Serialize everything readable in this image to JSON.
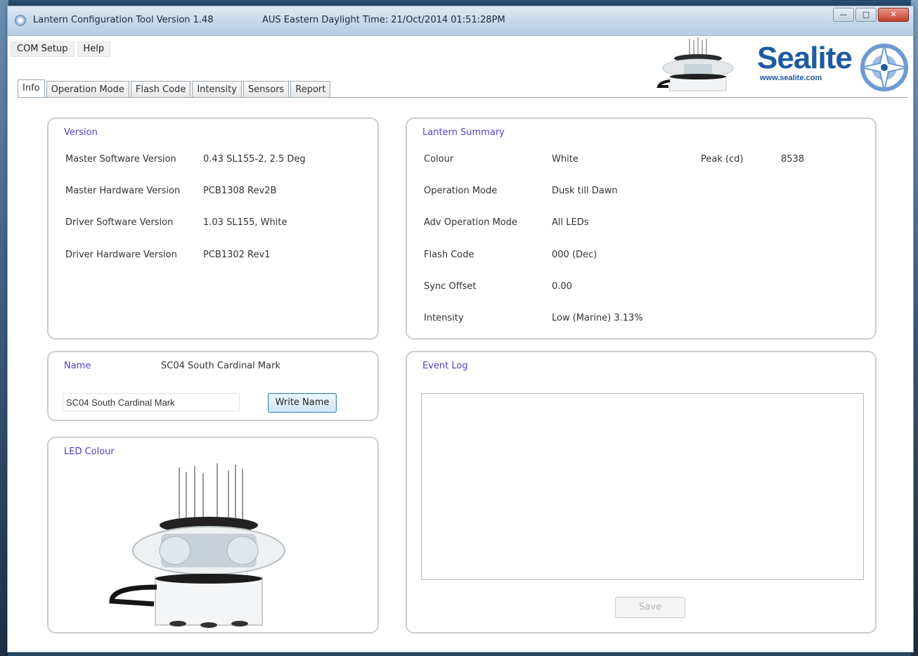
{
  "window": {
    "title": "Lantern Configuration Tool Version 1.48",
    "time_label": "AUS Eastern Daylight Time: 21/Oct/2014 01:51:28PM"
  },
  "menu": [
    "COM Setup",
    "Help"
  ],
  "logo": {
    "brand": "Sealite",
    "url": "www.sealite.com"
  },
  "tabs": [
    "Info",
    "Operation Mode",
    "Flash Code",
    "Intensity",
    "Sensors",
    "Report"
  ],
  "active_tab": "Info",
  "version_panel": {
    "title": "Version",
    "rows": [
      {
        "label": "Master Software Version",
        "value": "0.43 SL155-2, 2.5 Deg"
      },
      {
        "label": "Master Hardware Version",
        "value": "PCB1308 Rev2B"
      },
      {
        "label": "Driver Software Version",
        "value": "1.03 SL155, White"
      },
      {
        "label": "Driver Hardware Version",
        "value": "PCB1302 Rev1"
      }
    ]
  },
  "summary_panel": {
    "title": "Lantern Summary",
    "rows": [
      {
        "label": "Colour",
        "value": "White"
      },
      {
        "label": "Operation Mode",
        "value": "Dusk till Dawn"
      },
      {
        "label": "Adv Operation Mode",
        "value": "All LEDs"
      },
      {
        "label": "Flash Code",
        "value": "000 (Dec)"
      },
      {
        "label": "Sync Offset",
        "value": "0.00"
      },
      {
        "label": "Intensity",
        "value": "Low (Marine) 3.13%"
      }
    ],
    "peak_label": "Peak (cd)",
    "peak_value": "8538"
  },
  "name_panel": {
    "title": "Name",
    "current_name": "SC04 South Cardinal Mark",
    "input_value": "SC04 South Cardinal Mark",
    "write_button": "Write Name"
  },
  "led_panel": {
    "title": "LED Colour"
  },
  "event_panel": {
    "title": "Event Log",
    "save_button": "Save"
  }
}
